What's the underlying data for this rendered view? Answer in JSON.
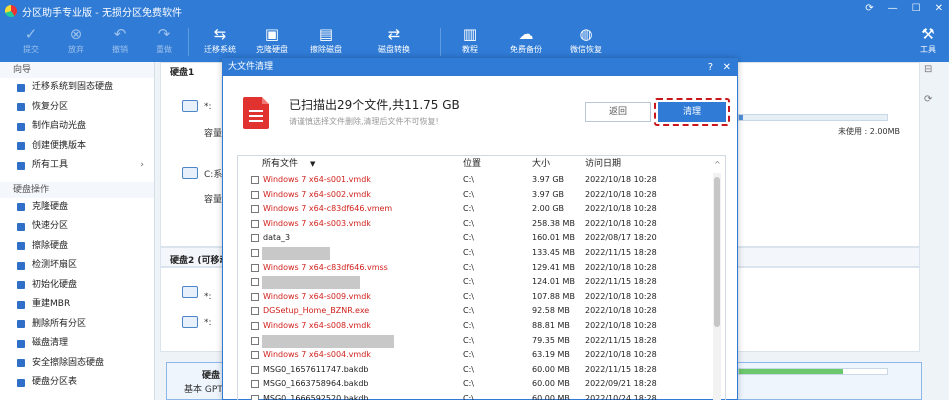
{
  "app": {
    "title": "分区助手专业版 - 无损分区免费软件"
  },
  "toolbar": {
    "items": [
      {
        "label": "提交",
        "icon": "check-icon"
      },
      {
        "label": "放弃",
        "icon": "cancel-icon"
      },
      {
        "label": "撤销",
        "icon": "undo-icon"
      },
      {
        "label": "重做",
        "icon": "redo-icon"
      },
      {
        "label": "迁移系统",
        "icon": "migrate-icon"
      },
      {
        "label": "克隆硬盘",
        "icon": "clone-icon"
      },
      {
        "label": "擦除磁盘",
        "icon": "wipe-icon"
      },
      {
        "label": "磁盘转换",
        "icon": "convert-icon"
      },
      {
        "label": "教程",
        "icon": "book-icon"
      },
      {
        "label": "免费备份",
        "icon": "backup-icon"
      },
      {
        "label": "微信恢复",
        "icon": "wechat-icon"
      },
      {
        "label": "工具",
        "icon": "tools-icon"
      }
    ]
  },
  "sidebar": {
    "sections": [
      {
        "title": "向导",
        "items": [
          "迁移系统到固态硬盘",
          "恢复分区",
          "制作启动光盘",
          "创建便携版本",
          "所有工具"
        ]
      },
      {
        "title": "硬盘操作",
        "items": [
          "克隆硬盘",
          "快速分区",
          "擦除硬盘",
          "检测坏扇区",
          "初始化硬盘",
          "重建MBR",
          "删除所有分区",
          "磁盘清理",
          "安全擦除固态硬盘",
          "硬盘分区表"
        ]
      }
    ]
  },
  "background": {
    "disk1_label": "硬盘1",
    "disk2_label": "硬盘2 (可移动",
    "disk3_label": "硬盘",
    "disk3_sub": "基本 GPT",
    "part_star": "*:",
    "part_c": "C:系统",
    "capacity": "容量",
    "unalloc": "未使用 : 2.00MB"
  },
  "dialog": {
    "title": "大文件清理",
    "help": "?",
    "close": "✕",
    "headline": "已扫描出29个文件,共11.75 GB",
    "subline": "请谨慎选择文件删除,清理后文件不可恢复!",
    "back_button": "返回",
    "clean_button": "清理",
    "columns": {
      "name": "所有文件",
      "location": "位置",
      "size": "大小",
      "time": "访问日期"
    },
    "rows": [
      {
        "name": "Windows 7 x64-s001.vmdk",
        "loc": "C:\\",
        "size": "3.97 GB",
        "time": "2022/10/18 10:28",
        "red": true
      },
      {
        "name": "Windows 7 x64-s002.vmdk",
        "loc": "C:\\",
        "size": "3.97 GB",
        "time": "2022/10/18 10:28",
        "red": true
      },
      {
        "name": "Windows 7 x64-c83df646.vmem",
        "loc": "C:\\",
        "size": "2.00 GB",
        "time": "2022/10/18 10:28",
        "red": true
      },
      {
        "name": "Windows 7 x64-s003.vmdk",
        "loc": "C:\\",
        "size": "258.38 MB",
        "time": "2022/10/18 10:28",
        "red": true
      },
      {
        "name": "data_3",
        "loc": "C:\\",
        "size": "160.01 MB",
        "time": "2022/08/17 18:20",
        "red": false
      },
      {
        "name": "",
        "loc": "C:\\",
        "size": "133.45 MB",
        "time": "2022/11/15 18:28",
        "red": false,
        "blur": 68
      },
      {
        "name": "Windows 7 x64-c83df646.vmss",
        "loc": "C:\\",
        "size": "129.41 MB",
        "time": "2022/10/18 10:28",
        "red": true
      },
      {
        "name": "",
        "loc": "C:\\",
        "size": "124.01 MB",
        "time": "2022/11/15 18:28",
        "red": false,
        "blur": 98
      },
      {
        "name": "Windows 7 x64-s009.vmdk",
        "loc": "C:\\",
        "size": "107.88 MB",
        "time": "2022/10/18 10:28",
        "red": true
      },
      {
        "name": "DGSetup_Home_BZNR.exe",
        "loc": "C:\\",
        "size": "92.58 MB",
        "time": "2022/10/18 10:28",
        "red": true
      },
      {
        "name": "Windows 7 x64-s008.vmdk",
        "loc": "C:\\",
        "size": "88.81 MB",
        "time": "2022/10/18 10:28",
        "red": true
      },
      {
        "name": "",
        "loc": "C:\\",
        "size": "79.35 MB",
        "time": "2022/11/15 18:28",
        "red": false,
        "blur": 132
      },
      {
        "name": "Windows 7 x64-s004.vmdk",
        "loc": "C:\\",
        "size": "63.19 MB",
        "time": "2022/10/18 10:28",
        "red": true
      },
      {
        "name": "MSG0_1657611747.bakdb",
        "loc": "C:\\",
        "size": "60.00 MB",
        "time": "2022/11/15 18:28",
        "red": false
      },
      {
        "name": "MSG0_1663758964.bakdb",
        "loc": "C:\\",
        "size": "60.00 MB",
        "time": "2022/09/21 18:28",
        "red": false
      },
      {
        "name": "MSG0_1666592520.bakdb",
        "loc": "C:\\",
        "size": "60.00 MB",
        "time": "2022/10/24 18:28",
        "red": false
      }
    ]
  },
  "colors": {
    "brand": "#2f7bd6",
    "danger": "#c8161d",
    "red_text": "#d0211c"
  }
}
